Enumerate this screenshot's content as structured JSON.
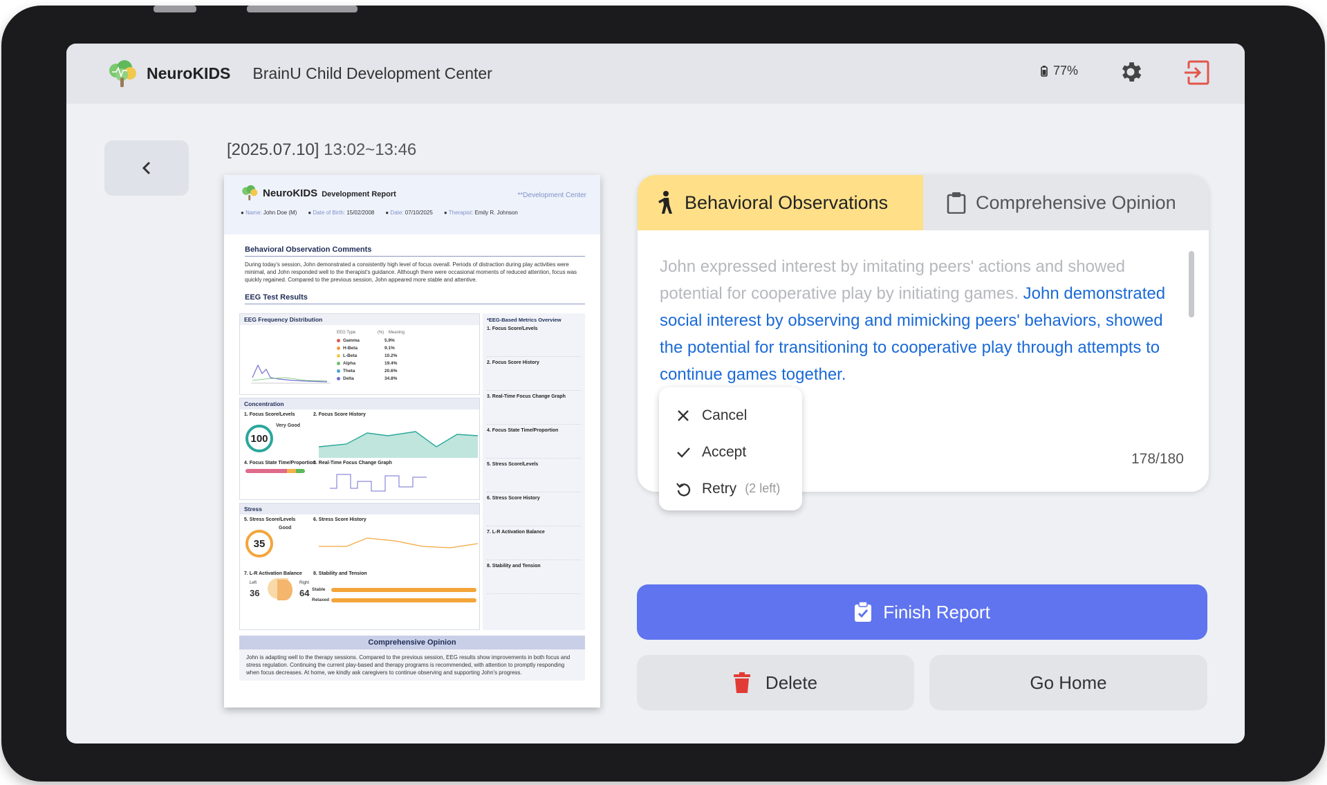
{
  "app": {
    "brand": "NeuroKIDS",
    "center_name": "BrainU Child Development Center",
    "battery": "77%"
  },
  "session": {
    "date": "[2025.07.10]",
    "time": "13:02~13:46"
  },
  "report": {
    "brand": "NeuroKIDS",
    "subtitle": "Development Report",
    "center": "**Development Center",
    "name_label": "Name:",
    "name": "John Doe (M)",
    "dob_label": "Date of Birth:",
    "dob": "15/02/2008",
    "date_label": "Date:",
    "date": "07/10/2025",
    "therapist_label": "Therapist:",
    "therapist": "Emily R. Johnson",
    "obs_title": "Behavioral Observation Comments",
    "obs_text": "During today's session, John demonstrated a consistently high level of focus overall. Periods of distraction during play activities were minimal, and John responded well to the therapist's guidance. Although there were occasional moments of reduced attention, focus was quickly regained. Compared to the previous session, John appeared more stable and attentive.",
    "eeg_title": "EEG Test Results",
    "freq_title": "EEG Frequency Distribution",
    "bands": [
      {
        "name": "Gamma",
        "pct": "5.9%",
        "color": "#e0554f"
      },
      {
        "name": "H-Beta",
        "pct": "9.1%",
        "color": "#f29a3b"
      },
      {
        "name": "L-Beta",
        "pct": "10.2%",
        "color": "#f5c842"
      },
      {
        "name": "Alpha",
        "pct": "19.4%",
        "color": "#6bbf6a"
      },
      {
        "name": "Theta",
        "pct": "20.6%",
        "color": "#4aa3d8"
      },
      {
        "name": "Delta",
        "pct": "34.8%",
        "color": "#6f6fd0"
      }
    ],
    "concentration": "Concentration",
    "focus_levels": "1. Focus Score/Levels",
    "focus_score": "100",
    "focus_grade": "Very Good",
    "focus_history": "2. Focus Score History",
    "focus_state": "4. Focus State Time/Proportion",
    "focus_realtime": "3. Real-Time Focus Change Graph",
    "stress": "Stress",
    "stress_levels": "5. Stress Score/Levels",
    "stress_score": "35",
    "stress_grade": "Good",
    "stress_history": "6. Stress Score History",
    "lr_title": "7. L-R Activation Balance",
    "left_label": "Left",
    "left_val": "36",
    "right_label": "Right",
    "right_val": "64",
    "stab_title": "8. Stability and Tension",
    "stable": "Stable",
    "relaxed": "Relaxed",
    "metrics_title": "*EEG-Based Metrics Overview",
    "metrics": [
      "1. Focus Score/Levels",
      "2. Focus Score History",
      "3. Real-Time Focus Change Graph",
      "4. Focus State Time/Proportion",
      "5. Stress Score/Levels",
      "6. Stress Score History",
      "7. L-R Activation Balance",
      "8. Stability and Tension"
    ],
    "opinion_title": "Comprehensive Opinion",
    "opinion_text": "John is adapting well to the therapy sessions. Compared to the previous session, EEG results show improvements in both focus and stress regulation. Continuing the current play-based and therapy programs is recommended, with attention to promptly responding when focus decreases. At home, we kindly ask caregivers to continue observing and supporting John's progress."
  },
  "tabs": {
    "behavioral": "Behavioral Observations",
    "opinion": "Comprehensive Opinion"
  },
  "editor": {
    "original_text": "John expressed interest by imitating peers' actions and showed potential for cooperative play by initiating games.",
    "suggested_text": "John demonstrated social interest by observing and mimicking peers' behaviors, showed the potential for transitioning to cooperative play through attempts to continue games together.",
    "char_count": "178/180"
  },
  "menu": {
    "cancel": "Cancel",
    "accept": "Accept",
    "retry": "Retry",
    "retry_left": "(2 left)"
  },
  "actions": {
    "finish": "Finish Report",
    "delete": "Delete",
    "home": "Go Home"
  },
  "colors": {
    "accent": "#5f74ee",
    "tab_active": "#ffdf88",
    "suggestion": "#1a6ad6",
    "logout": "#e2554a",
    "delete": "#e23b35"
  }
}
